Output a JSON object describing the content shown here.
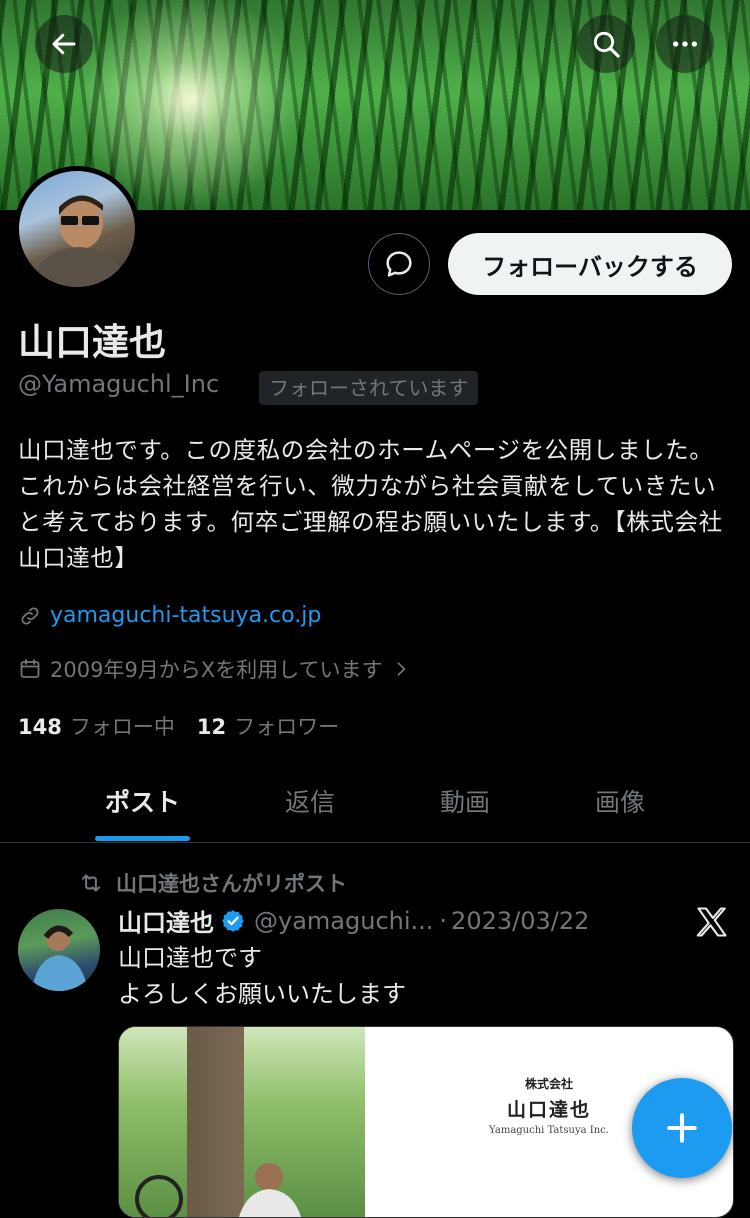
{
  "profile": {
    "name": "山口達也",
    "handle": "@Yamaguchl_Inc",
    "follows_you_badge": "フォローされています",
    "follow_back_label": "フォローバックする",
    "bio": "山口達也です。この度私の会社のホームページを公開しました。これからは会社経営を行い、微力ながら社会貢献をしていきたいと考えております。何卒ご理解の程お願いいたします。【株式会社 山口達也】",
    "website": "yamaguchi-tatsuya.co.jp",
    "joined": "2009年9月からXを利用しています",
    "following_count": "148",
    "following_label": "フォロー中",
    "followers_count": "12",
    "followers_label": "フォロワー"
  },
  "tabs": [
    {
      "label": "ポスト",
      "active": true
    },
    {
      "label": "返信"
    },
    {
      "label": "動画"
    },
    {
      "label": "画像"
    }
  ],
  "post": {
    "repost_label": "山口達也さんがリポスト",
    "author_name": "山口達也",
    "author_handle": "@yamaguchi...",
    "separator": "·",
    "date": "2023/03/22",
    "text_line1": "山口達也です",
    "text_line2": "よろしくお願いいたします",
    "media": {
      "company_small": "株式会社",
      "company_name": "山口達也",
      "company_romaji": "Yamaguchi Tatsuya Inc."
    }
  },
  "colors": {
    "accent": "#1d9bf0",
    "background": "#000000",
    "secondary_text": "#71767b",
    "verified": "#1d9bf0"
  },
  "icons": {
    "back": "back-arrow-icon",
    "search": "search-icon",
    "more": "more-dots-icon",
    "message": "message-bubble-icon",
    "link": "link-icon",
    "calendar": "calendar-icon",
    "repost": "repost-icon",
    "verified": "verified-badge-icon",
    "x_logo": "x-logo-icon",
    "compose": "plus-icon"
  }
}
